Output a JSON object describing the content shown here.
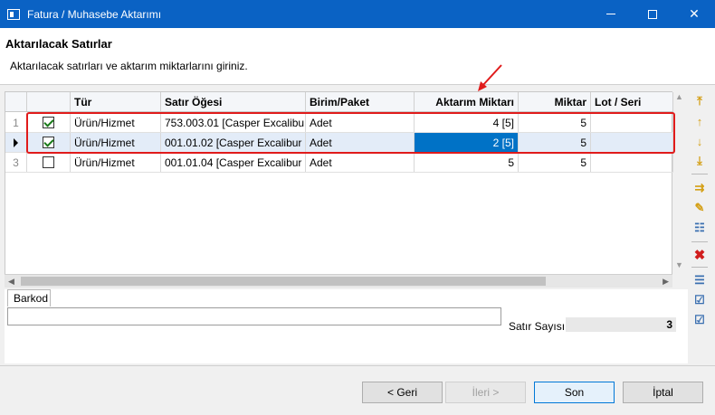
{
  "window": {
    "title": "Fatura / Muhasebe Aktarımı"
  },
  "header": {
    "title": "Aktarılacak Satırlar",
    "description": "Aktarılacak satırları ve aktarım miktarlarını giriniz."
  },
  "grid": {
    "columns": {
      "tur": "Tür",
      "satir": "Satır Öğesi",
      "birim": "Birim/Paket",
      "aktarim": "Aktarım Miktarı",
      "miktar": "Miktar",
      "lot": "Lot / Seri"
    },
    "rows": [
      {
        "index": "1",
        "checked": true,
        "tur": "Ürün/Hizmet",
        "satir": "753.003.01 [Casper Excalibu...",
        "birim": "Adet",
        "aktarim": "4 [5]",
        "miktar": "5",
        "lot": ""
      },
      {
        "index": "",
        "checked": true,
        "tur": "Ürün/Hizmet",
        "satir": "001.01.02 [Casper Excalibur ...",
        "birim": "Adet",
        "aktarim": "2 [5]",
        "miktar": "5",
        "lot": ""
      },
      {
        "index": "3",
        "checked": false,
        "tur": "Ürün/Hizmet",
        "satir": "001.01.04 [Casper Excalibur ...",
        "birim": "Adet",
        "aktarim": "5",
        "miktar": "5",
        "lot": ""
      }
    ]
  },
  "barkod": {
    "tab_label": "Barkod",
    "value": ""
  },
  "summary": {
    "count_label": "Satır Sayısı",
    "count_value": "3"
  },
  "buttons": {
    "back": "< Geri",
    "next": "İleri >",
    "finish": "Son",
    "cancel": "İptal"
  },
  "icons": {
    "move_top": "move-top-icon",
    "move_up": "move-up-icon",
    "move_down": "move-down-icon",
    "move_bottom": "move-bottom-icon",
    "insert_row": "insert-row-icon",
    "edit_row": "edit-row-icon",
    "properties": "properties-icon",
    "delete": "delete-icon",
    "list1": "list-icon",
    "list2": "checklist-icon",
    "list3": "checklist-alt-icon"
  },
  "colors": {
    "titlebar": "#0a62c4",
    "selected_cell": "#0072c6",
    "highlight_box": "#e01b1b"
  }
}
